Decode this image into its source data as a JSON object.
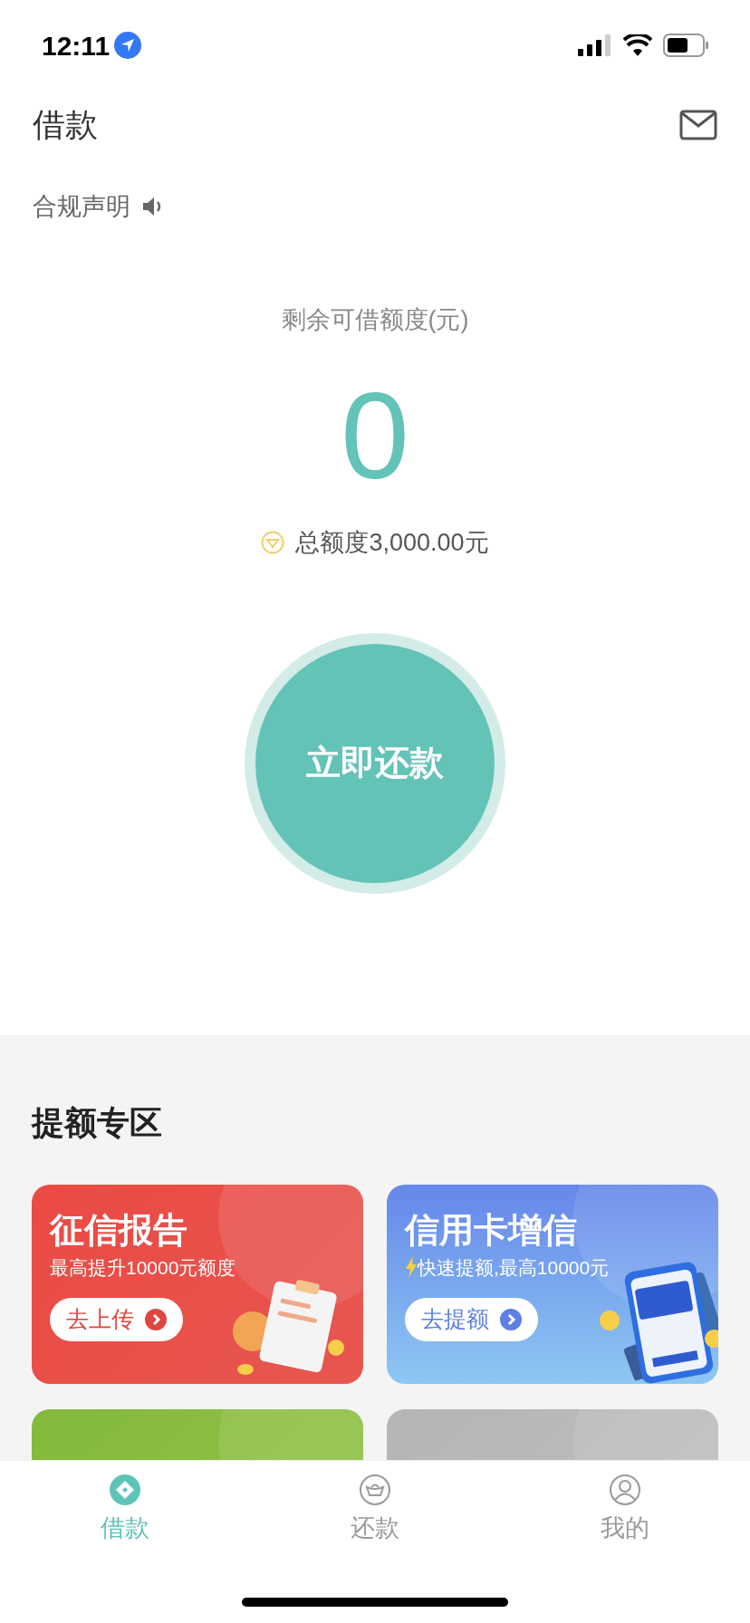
{
  "status_bar": {
    "time": "12:11"
  },
  "header": {
    "title": "借款"
  },
  "notice": {
    "label": "合规声明"
  },
  "credit": {
    "label": "剩余可借额度(元)",
    "amount": "0",
    "total": "总额度3,000.00元"
  },
  "main_button": {
    "label": "立即还款"
  },
  "section": {
    "title": "提额专区"
  },
  "cards": [
    {
      "title": "征信报告",
      "subtitle": "最高提升10000元额度",
      "bolt": false,
      "button": "去上传"
    },
    {
      "title": "信用卡增信",
      "subtitle": "快速提额,最高10000元",
      "bolt": true,
      "button": "去提额"
    }
  ],
  "tabs": [
    {
      "label": "借款",
      "selected": true
    },
    {
      "label": "还款",
      "selected": false
    },
    {
      "label": "我的",
      "selected": false
    }
  ]
}
